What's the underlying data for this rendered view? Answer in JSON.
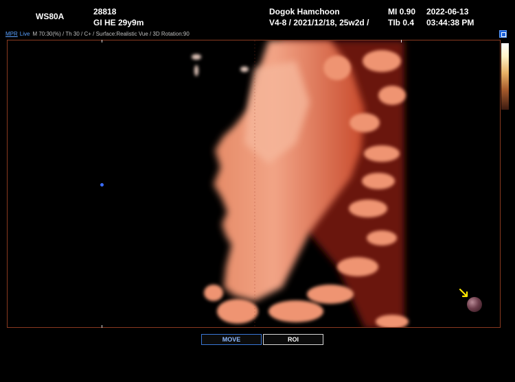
{
  "header": {
    "model": "WS80A",
    "patient_id": "28818",
    "patient_info": "GI HE 29y9m",
    "hospital": "Dogok Hamchoon",
    "probe_info": "V4-8 / 2021/12/18, 25w2d /",
    "mi": "MI  0.90",
    "tib": "TIb 0.4",
    "date": "2022-06-13",
    "time": "03:44:38 PM"
  },
  "status": {
    "mode": "MPR",
    "live": "Live",
    "params": "M 70:30(%) / Th 30 / C+ / Surface:Realistic Vue / 3D Rotation:90"
  },
  "buttons": {
    "move": "MOVE",
    "roi": "ROI"
  },
  "colors": {
    "frame_border": "#8a3a20",
    "active_button_border": "#3a78d8",
    "mpr_text": "#5aa0ff",
    "orientation_arrow": "#ffe800"
  },
  "icons": {
    "corner": "view-layout-icon",
    "orientation": "orientation-sphere-icon",
    "pointer": "arrow-icon"
  }
}
